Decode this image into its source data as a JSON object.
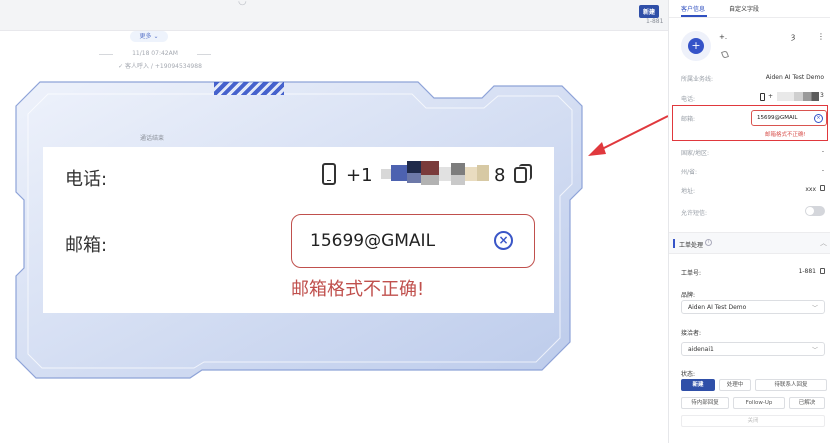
{
  "chat": {
    "top_glyph": "◡",
    "new_badge": "新建",
    "ticket_ref": "1-881",
    "more_label": "更多 ⌄",
    "system_time": "11/18 07:42AM",
    "system_call": "✓ 客人呼入 / +19094534988",
    "call_end": "通话结束"
  },
  "zoom": {
    "phone_label": "电话:",
    "phone_value_start": "+1",
    "phone_value_end": "8",
    "email_label": "邮箱:",
    "email_value": "15699@GMAIL",
    "email_error": "邮箱格式不正确!"
  },
  "sidebar": {
    "tabs": {
      "customer_info": "客户信息",
      "custom_fields": "自定义字段"
    },
    "contact": {
      "name": "+.",
      "glyph": "ȝ",
      "more": "⋮"
    },
    "fields": {
      "business_line_label": "所属业务线:",
      "business_line_value": "Aiden AI Test Demo",
      "phone_label": "电话:",
      "phone_value_start": "+",
      "phone_value_end": "3",
      "email_label": "邮箱:",
      "email_value": "15699@GMAIL",
      "email_error": "邮箱格式不正确!",
      "country_label": "国家/地区:",
      "country_value": "-",
      "state_label": "州/省:",
      "state_value": "-",
      "address_label": "地址:",
      "address_value": "xxx",
      "sms_label": "允许短信:"
    },
    "ticket": {
      "section_title": "工单处理",
      "number_label": "工单号:",
      "number_value": "1-881",
      "brand_label": "品牌:",
      "brand_value": "Aiden AI Test Demo",
      "assignee_label": "接洽者:",
      "assignee_value": "aidenai1",
      "status_label": "状态:",
      "status_buttons": [
        "新建",
        "处理中",
        "待联系人回复",
        "待内部回复",
        "Follow-Up",
        "已解决",
        "关闭"
      ]
    }
  },
  "colors": {
    "accent": "#2f4fa8",
    "error": "#d9534f",
    "annotation": "#e0383d"
  }
}
